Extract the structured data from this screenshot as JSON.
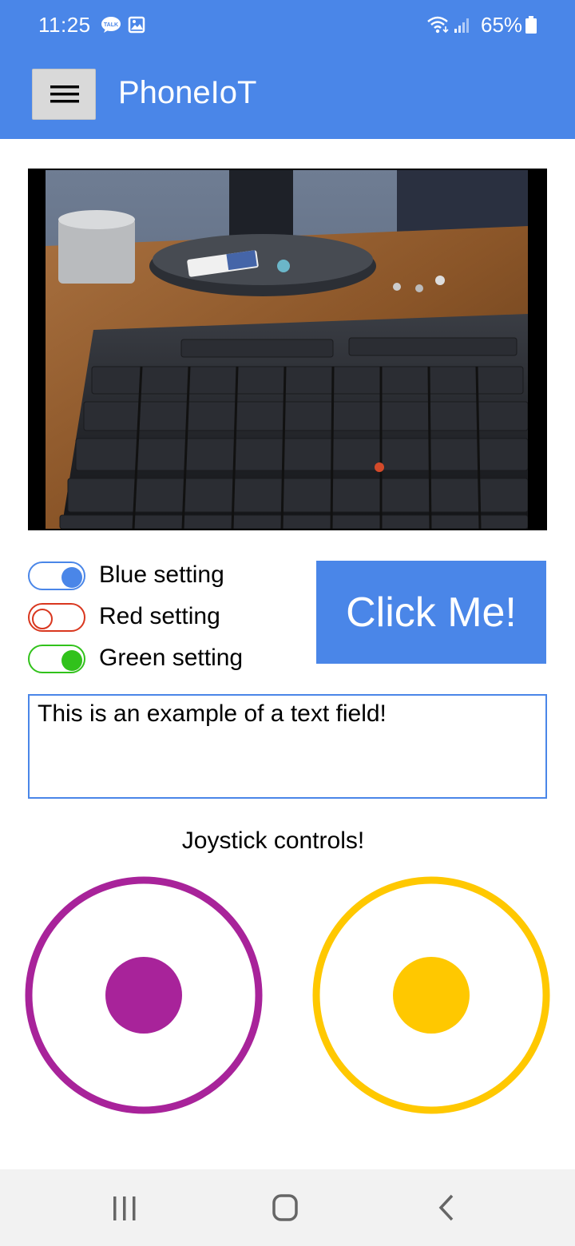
{
  "status_bar": {
    "time": "11:25",
    "notification_icons": [
      "talk-icon",
      "gallery-icon"
    ],
    "battery_percent": "65%",
    "system_icons": [
      "wifi-icon",
      "signal-icon",
      "battery-icon"
    ]
  },
  "app_bar": {
    "title": "PhoneIoT",
    "menu_icon": "hamburger-menu-icon",
    "color": "#4a86e8"
  },
  "camera": {
    "content": "camera-feed-keyboard-desk"
  },
  "toggles": [
    {
      "label": "Blue setting",
      "checked": true,
      "color": "#4a86e8"
    },
    {
      "label": "Red setting",
      "checked": false,
      "color": "#d9371f"
    },
    {
      "label": "Green setting",
      "checked": true,
      "color": "#31c21b"
    }
  ],
  "click_button": {
    "label": "Click Me!",
    "color": "#4a86e8"
  },
  "text_field": {
    "value": "This is an example of a text field!"
  },
  "joystick_caption": "Joystick controls!",
  "joysticks": [
    {
      "color": "#a8239a"
    },
    {
      "color": "#ffc800"
    }
  ],
  "nav_bar": {
    "buttons": [
      "recent-apps-icon",
      "home-icon",
      "back-icon"
    ]
  }
}
